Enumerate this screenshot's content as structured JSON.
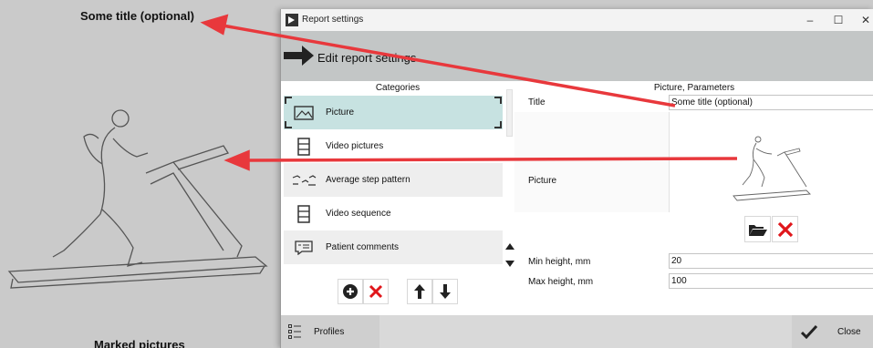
{
  "background": {
    "title": "Some title (optional)",
    "caption": "Marked pictures"
  },
  "window": {
    "title": "Report settings",
    "min_glyph": "–",
    "max_glyph": "☐",
    "close_glyph": "✕"
  },
  "header": {
    "title": "Edit report settings"
  },
  "categories": {
    "header": "Categories",
    "items": [
      {
        "label": "Picture",
        "icon": "picture-icon"
      },
      {
        "label": "Video pictures",
        "icon": "film-icon"
      },
      {
        "label": "Average step pattern",
        "icon": "step-pattern-icon"
      },
      {
        "label": "Video sequence",
        "icon": "film-icon"
      },
      {
        "label": "Patient comments",
        "icon": "comment-card-icon"
      }
    ],
    "selected": "Picture"
  },
  "parameters": {
    "header": "Picture, Parameters",
    "title_label": "Title",
    "title_value": "Some title (optional)",
    "picture_label": "Picture",
    "min_height_label": "Min height, mm",
    "min_height_value": "20",
    "max_height_label": "Max height, mm",
    "max_height_value": "100"
  },
  "footer": {
    "profiles_label": "Profiles",
    "close_label": "Close"
  },
  "colors": {
    "selected_row": "#c7e2e1",
    "delete_red": "#e0161b",
    "annotation_arrow": "#e8383c"
  }
}
